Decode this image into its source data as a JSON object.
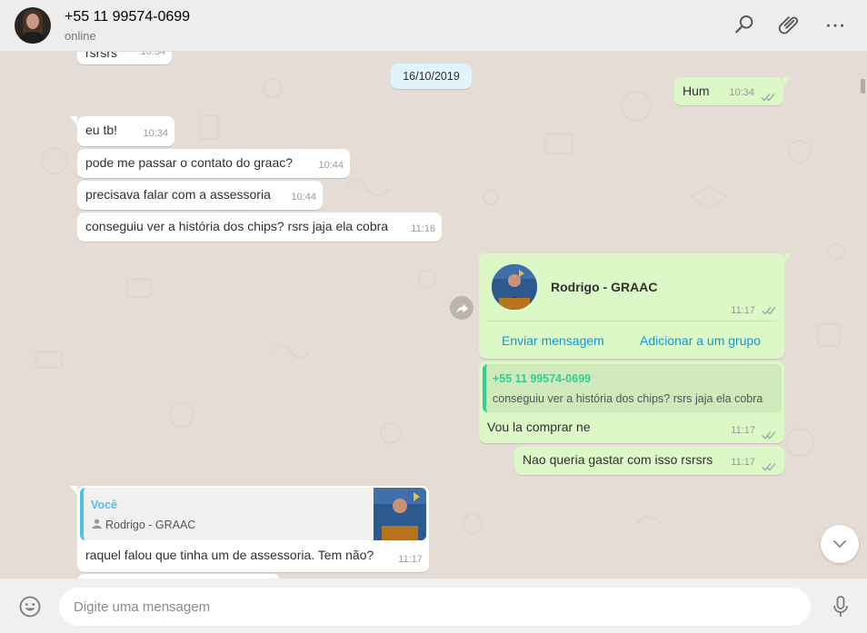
{
  "header": {
    "contact_name": "+55 11 99574-0699",
    "status": "online"
  },
  "chat": {
    "date_chip": "16/10/2019",
    "messages": [
      {
        "dir": "in",
        "text": "rsrsrs",
        "time": "10:34"
      },
      {
        "dir": "out",
        "text": "Hum",
        "time": "10:34",
        "status": "read"
      },
      {
        "dir": "in",
        "text": "eu tb!",
        "time": "10:34"
      },
      {
        "dir": "in",
        "text": "pode me passar o contato do graac?",
        "time": "10:44"
      },
      {
        "dir": "in",
        "text": "precisava falar com a assessoria",
        "time": "10:44"
      },
      {
        "dir": "in",
        "text": "conseguiu ver a história dos chips? rsrs jaja ela cobra",
        "time": "11:16"
      }
    ],
    "contact_card": {
      "name": "Rodrigo - GRAAC",
      "time": "11:17",
      "action_send": "Enviar mensagem",
      "action_add": "Adicionar a um grupo"
    },
    "reply_out": {
      "quoted_author": "+55 11 99574-0699",
      "quoted_text": "conseguiu ver a história dos chips? rsrs jaja ela cobra",
      "text": "Vou la comprar ne",
      "time": "11:17"
    },
    "msg_out_2": {
      "text": "Nao queria gastar com isso rsrsrs",
      "time": "11:17"
    },
    "reply_in": {
      "quoted_author": "Você",
      "quoted_text": "Rodrigo - GRAAC",
      "text": "raquel falou que tinha um de assessoria. Tem não?",
      "time": "11:17"
    }
  },
  "composer": {
    "placeholder": "Digite uma mensagem"
  },
  "icons": {
    "search": "search-icon",
    "attach": "paperclip-icon",
    "menu": "more-options-icon",
    "emoji": "emoji-icon",
    "mic": "microphone-icon",
    "forward": "forward-icon",
    "scroll": "chevron-down-icon"
  },
  "colors": {
    "incoming_bubble": "#ffffff",
    "outgoing_bubble": "#dcf8c6",
    "link": "#039be5",
    "quote_green": "#35cd96",
    "quote_blue": "#53bdeb",
    "chat_background": "#e5ddd5"
  }
}
